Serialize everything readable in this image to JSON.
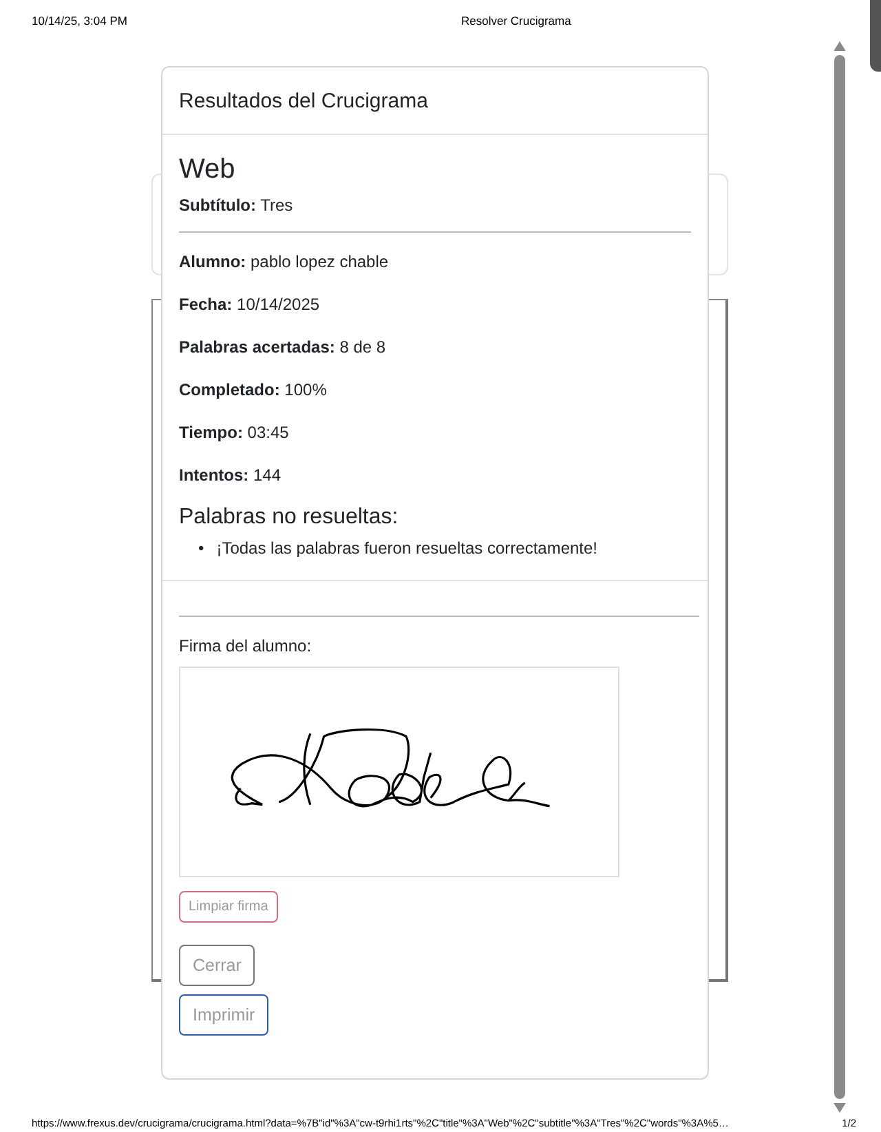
{
  "print_header": {
    "date": "10/14/25, 3:04 PM",
    "title": "Resolver Crucigrama"
  },
  "modal": {
    "title": "Resultados del Crucigrama",
    "heading": "Web",
    "subtitle": "**Subtítulo:** Tres",
    "details": [
      "**Alumno:** pablo lopez chable",
      "**Fecha:** 10/14/2025",
      "**Palabras acertadas:** 8 de 8",
      "**Completado:** 100%",
      "**Tiempo:** 03:45",
      "**Intentos:** 144"
    ],
    "unsolved_heading": "Palabras no resueltas:",
    "bullet": "•",
    "unsolved_items": [
      "¡Todas las palabras fueron resueltas correctamente!"
    ],
    "signature_label": "Firma del alumno:",
    "buttons": [
      {
        "label": "Limpiar firma",
        "kind": "danger"
      },
      {
        "label": "Cerrar",
        "kind": "secondary"
      },
      {
        "label": "Imprimir",
        "kind": "primary"
      }
    ]
  },
  "print_footer": {
    "url": "https://www.frexus.dev/crucigrama/crucigrama.html?data=%7B\"id\"%3A\"cw-t9rhi1rts\"%2C\"title\"%3A\"Web\"%2C\"subtitle\"%3A\"Tres\"%2C\"words\"%3A%5…",
    "page": "1/2"
  }
}
